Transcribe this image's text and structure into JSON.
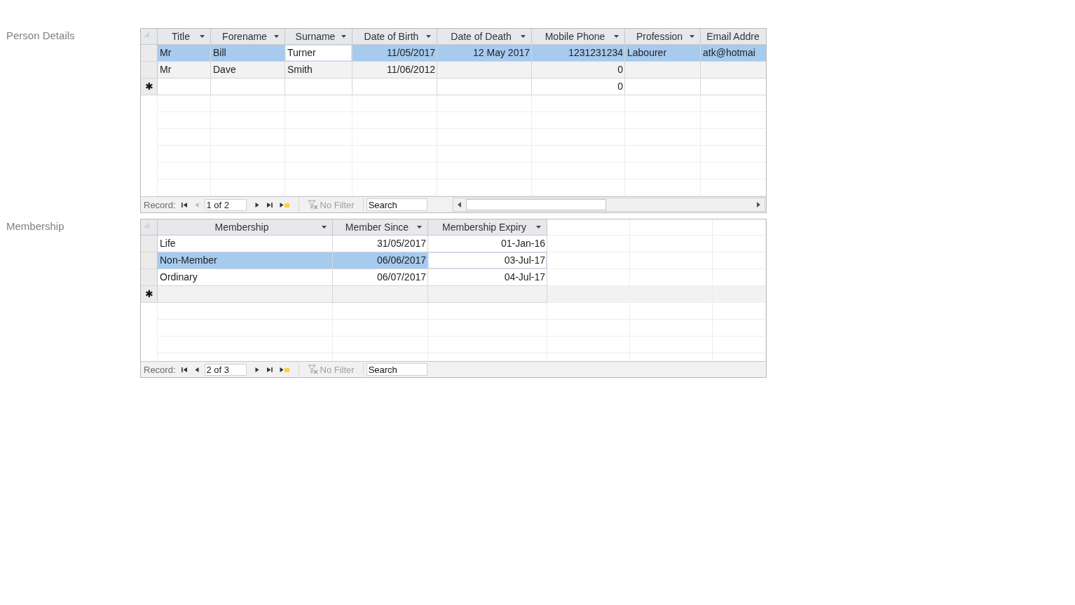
{
  "forms": [
    {
      "label": "Person Details",
      "table": {
        "columns": [
          {
            "title": "Title",
            "kind": "text",
            "menu": true
          },
          {
            "title": "Forename",
            "kind": "text",
            "menu": true
          },
          {
            "title": "Surname",
            "kind": "text",
            "menu": true
          },
          {
            "title": "Date of Birth",
            "kind": "number",
            "menu": true
          },
          {
            "title": "Date of Death",
            "kind": "number",
            "menu": true
          },
          {
            "title": "Mobile Phone",
            "kind": "number",
            "menu": true
          },
          {
            "title": "Profession",
            "kind": "text",
            "menu": true
          },
          {
            "title": "Email Addre",
            "kind": "text",
            "menu": false
          }
        ],
        "rows": [
          {
            "selected": true,
            "cells": [
              {
                "text": "Mr",
                "focused": false
              },
              {
                "text": "Bill",
                "focused": false
              },
              {
                "text": "Turner",
                "focused": true
              },
              {
                "text": "11/05/2017",
                "focused": false
              },
              {
                "text": "12 May 2017",
                "focused": false
              },
              {
                "text": "1231231234",
                "focused": false
              },
              {
                "text": "Labourer",
                "focused": false
              },
              {
                "text": "atk@hotmai",
                "focused": false
              }
            ]
          },
          {
            "selected": false,
            "cells": [
              {
                "text": "Mr",
                "focused": false
              },
              {
                "text": "Dave",
                "focused": false
              },
              {
                "text": "Smith",
                "focused": false
              },
              {
                "text": "11/06/2012",
                "focused": false
              },
              null,
              {
                "text": "0",
                "focused": false
              },
              null,
              null
            ]
          }
        ],
        "new_row": {
          "marker": "✱",
          "cells": [
            null,
            null,
            null,
            null,
            null,
            "0",
            null,
            null
          ]
        }
      },
      "navigation": {
        "label": "Record:",
        "position": "1 of 2",
        "buttons": [
          {
            "kind": "first",
            "disabled": false
          },
          {
            "kind": "previous",
            "disabled": true
          },
          {
            "kind": "next",
            "disabled": false
          },
          {
            "kind": "last",
            "disabled": false
          },
          {
            "kind": "new",
            "disabled": false
          }
        ],
        "filter": {
          "label": "No Filter",
          "active": false
        },
        "search": {
          "placeholder": "Search"
        },
        "horizontal_scrollbar": true
      }
    },
    {
      "label": "Membership",
      "table": {
        "columns": [
          {
            "title": "Membership",
            "kind": "text",
            "menu": true
          },
          {
            "title": "Member Since",
            "kind": "number",
            "menu": true
          },
          {
            "title": "Membership Expiry",
            "kind": "number",
            "menu": true
          }
        ],
        "rows": [
          {
            "selected": false,
            "cells": [
              {
                "text": "Life",
                "focused": false
              },
              {
                "text": "31/05/2017",
                "focused": false
              },
              {
                "text": "01-Jan-16",
                "focused": false
              }
            ]
          },
          {
            "selected": true,
            "cells": [
              {
                "text": "Non-Member",
                "focused": false
              },
              {
                "text": "06/06/2017",
                "focused": false
              },
              {
                "text": "03-Jul-17",
                "focused": true
              }
            ]
          },
          {
            "selected": false,
            "cells": [
              {
                "text": "Ordinary",
                "focused": false
              },
              {
                "text": "06/07/2017",
                "focused": false
              },
              {
                "text": "04-Jul-17",
                "focused": false
              }
            ]
          }
        ],
        "new_row": {
          "marker": "✱",
          "cells": [
            null,
            null,
            null
          ]
        }
      },
      "navigation": {
        "label": "Record:",
        "position": "2 of 3",
        "buttons": [
          {
            "kind": "first",
            "disabled": false
          },
          {
            "kind": "previous",
            "disabled": false
          },
          {
            "kind": "next",
            "disabled": false
          },
          {
            "kind": "last",
            "disabled": false
          },
          {
            "kind": "new",
            "disabled": false
          }
        ],
        "filter": {
          "label": "No Filter",
          "active": false
        },
        "search": {
          "placeholder": "Search"
        },
        "horizontal_scrollbar": false
      }
    }
  ]
}
